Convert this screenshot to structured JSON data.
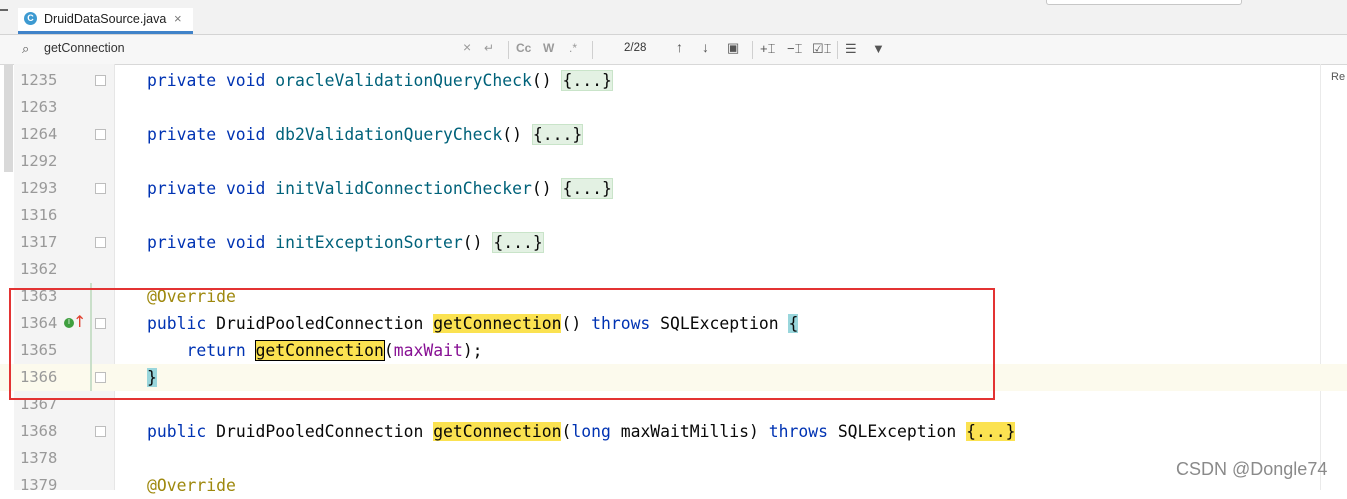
{
  "tab": {
    "file_badge": "C",
    "file_name": "DruidDataSource.java",
    "close": "×"
  },
  "search": {
    "query": "getConnection",
    "counter": "2/28",
    "match_case": "Cc",
    "words": "W",
    "regex": ".*"
  },
  "editor": {
    "lines": [
      {
        "no": "1235",
        "segs": [
          [
            "kw",
            "private void "
          ],
          [
            "fn",
            "oracleValidationQueryCheck"
          ],
          [
            "",
            "() "
          ],
          [
            "fb",
            "{...}"
          ]
        ]
      },
      {
        "no": "1263",
        "segs": []
      },
      {
        "no": "1264",
        "segs": [
          [
            "kw",
            "private void "
          ],
          [
            "fn",
            "db2ValidationQueryCheck"
          ],
          [
            "",
            "() "
          ],
          [
            "fb",
            "{...}"
          ]
        ]
      },
      {
        "no": "1292",
        "segs": []
      },
      {
        "no": "1293",
        "segs": [
          [
            "kw",
            "private void "
          ],
          [
            "fn",
            "initValidConnectionChecker"
          ],
          [
            "",
            "() "
          ],
          [
            "fb",
            "{...}"
          ]
        ]
      },
      {
        "no": "1316",
        "segs": []
      },
      {
        "no": "1317",
        "segs": [
          [
            "kw",
            "private void "
          ],
          [
            "fn",
            "initExceptionSorter"
          ],
          [
            "",
            "() "
          ],
          [
            "fb",
            "{...}"
          ]
        ]
      },
      {
        "no": "1362",
        "segs": []
      },
      {
        "no": "1363",
        "segs": [
          [
            "ann",
            "@Override"
          ]
        ]
      },
      {
        "no": "1364",
        "segs": [
          [
            "kw",
            "public "
          ],
          [
            "",
            "DruidPooledConnection "
          ],
          [
            "hl",
            "getConnection"
          ],
          [
            "",
            "() "
          ],
          [
            "kw",
            "throws "
          ],
          [
            "",
            "SQLException "
          ],
          [
            "br",
            "{"
          ]
        ]
      },
      {
        "no": "1365",
        "segs": [
          [
            "",
            "    "
          ],
          [
            "kw",
            "return "
          ],
          [
            "hlb",
            "getConnection"
          ],
          [
            "",
            "("
          ],
          [
            "param",
            "maxWait"
          ],
          [
            "",
            ");"
          ]
        ]
      },
      {
        "no": "1366",
        "segs": [
          [
            "br",
            "}"
          ]
        ]
      },
      {
        "no": "1367",
        "segs": []
      },
      {
        "no": "1368",
        "segs": [
          [
            "kw",
            "public "
          ],
          [
            "",
            "DruidPooledConnection "
          ],
          [
            "hl",
            "getConnection"
          ],
          [
            "",
            "("
          ],
          [
            "kw",
            "long "
          ],
          [
            "",
            "maxWaitMillis) "
          ],
          [
            "kw",
            "throws "
          ],
          [
            "",
            "SQLException "
          ],
          [
            "hl",
            "{...}"
          ]
        ]
      },
      {
        "no": "1378",
        "segs": []
      },
      {
        "no": "1379",
        "segs": [
          [
            "ann",
            "@Override"
          ]
        ]
      }
    ]
  },
  "right_label": "Re",
  "watermark": "CSDN @Dongle74"
}
